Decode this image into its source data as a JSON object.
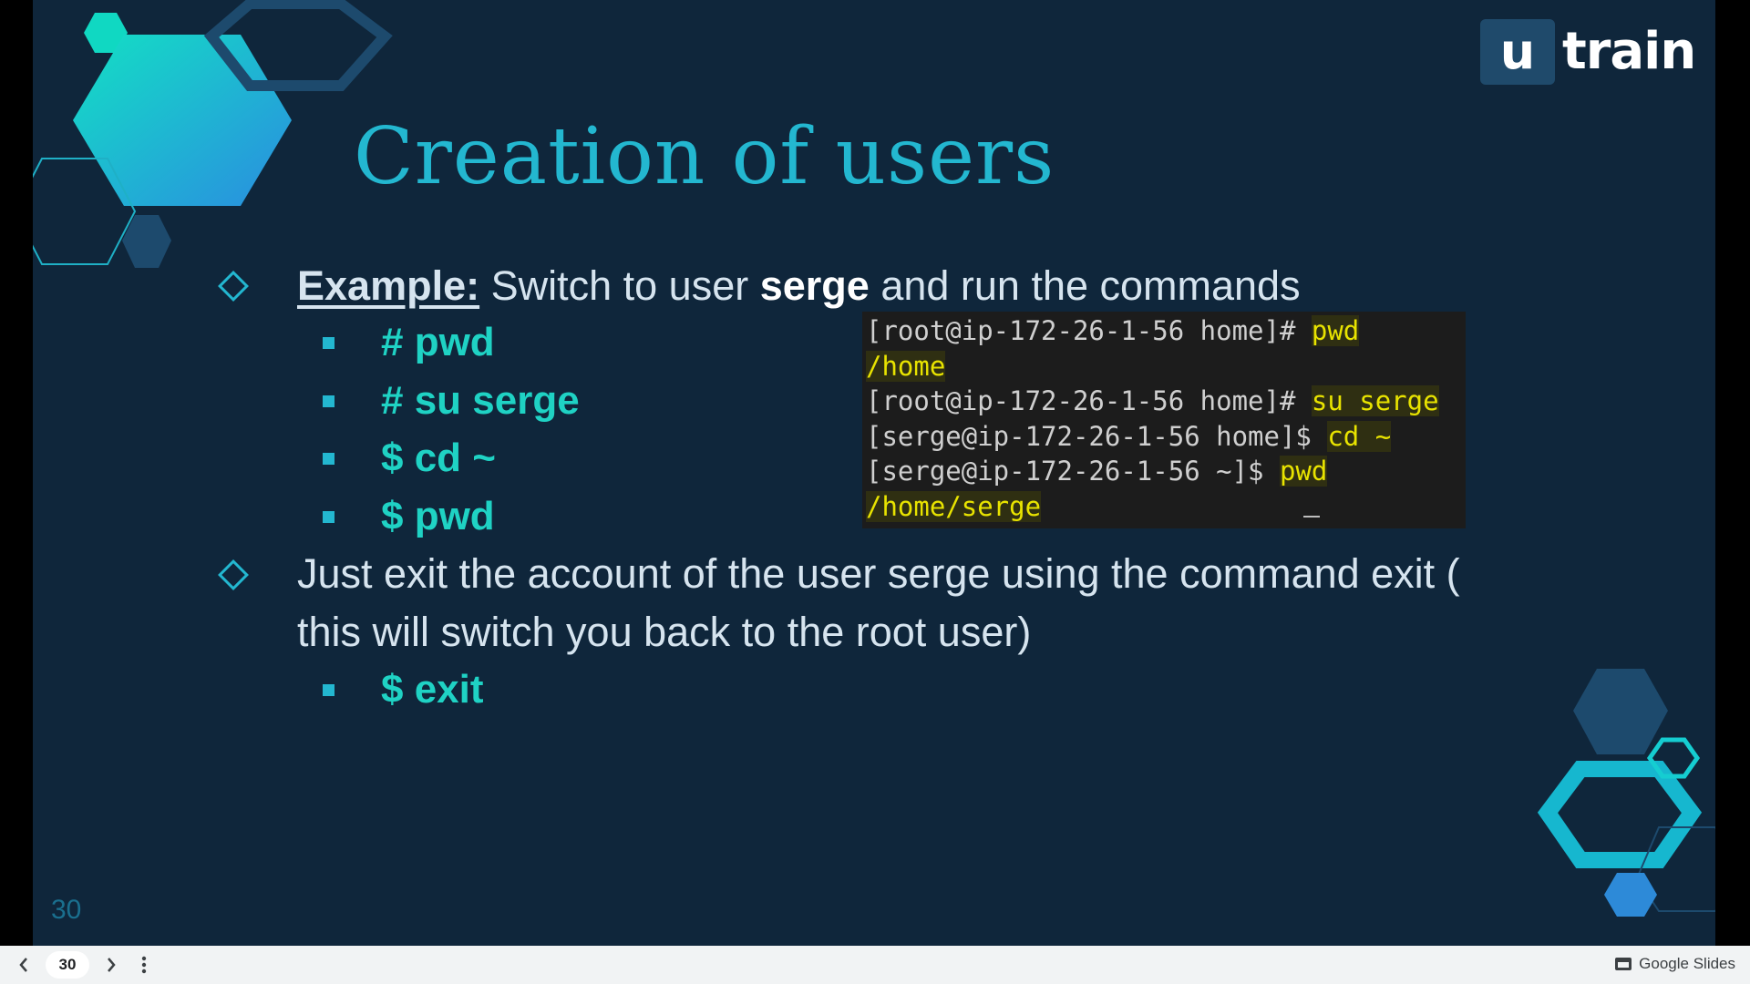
{
  "slide": {
    "title": "Creation of users",
    "slide_number": "30",
    "logo": {
      "mark": "u",
      "word": "train"
    },
    "bullets": [
      {
        "lead": "Example:",
        "text_a": " Switch to user ",
        "bold": "serge",
        "text_b": " and run the commands",
        "subitems": [
          "# pwd",
          "# su serge",
          "$ cd ~",
          "$ pwd"
        ]
      },
      {
        "line1": "Just exit the account of the user serge using the command exit (",
        "line2": "this will switch you back to the root user)",
        "subitems": [
          "$ exit"
        ]
      }
    ],
    "terminal": [
      {
        "prompt": "[root@ip-172-26-1-56 home]# ",
        "cmd": "pwd"
      },
      {
        "prompt": "",
        "cmd": "/home"
      },
      {
        "prompt": "[root@ip-172-26-1-56 home]# ",
        "cmd": "su serge"
      },
      {
        "prompt": "[serge@ip-172-26-1-56 home]$ ",
        "cmd": "cd ~"
      },
      {
        "prompt": "[serge@ip-172-26-1-56 ~]$ ",
        "cmd": "pwd"
      },
      {
        "prompt": "",
        "cmd": "/home/serge"
      }
    ]
  },
  "toolbar": {
    "prev_icon": "chevron-left-icon",
    "page": "30",
    "next_icon": "chevron-right-icon",
    "more_icon": "more-vert-icon",
    "brand": "Google Slides"
  },
  "colors": {
    "background": "#0f263b",
    "accent": "#23b7d0",
    "command": "#1fd2c4",
    "highlight": "#e8e300"
  }
}
